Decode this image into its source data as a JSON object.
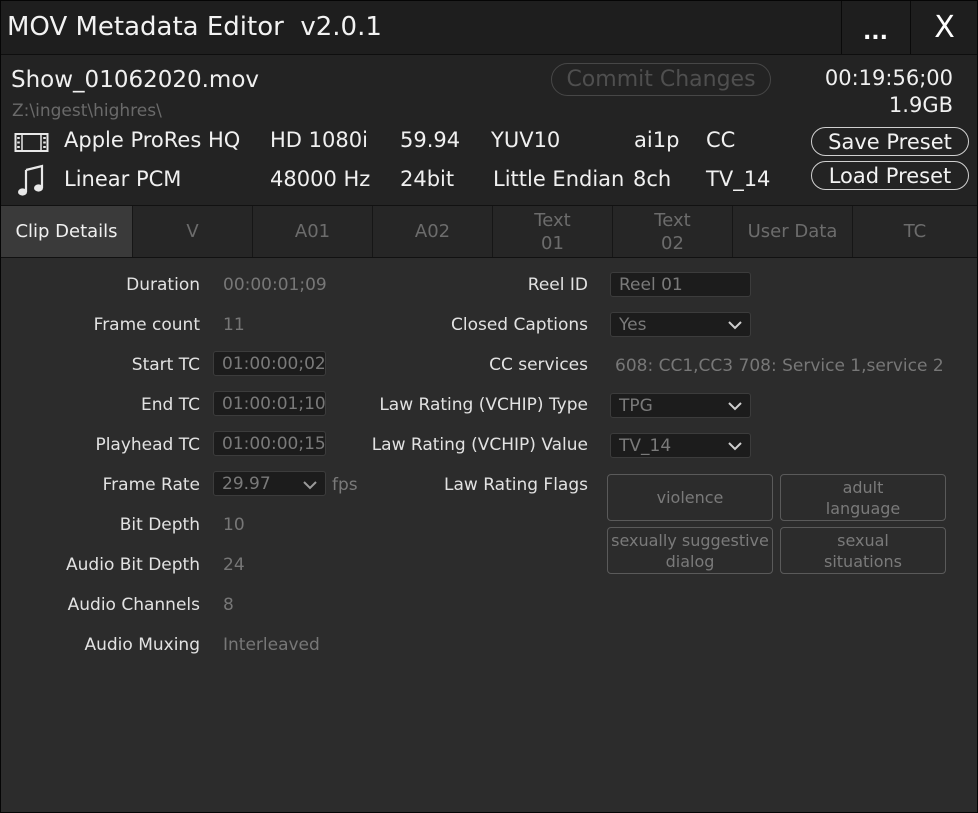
{
  "window": {
    "title": "MOV Metadata Editor  v2.0.1",
    "more_label": "...",
    "close_label": "X"
  },
  "file": {
    "name": "Show_01062020.mov",
    "path": "Z:\\ingest\\highres\\",
    "duration": "00:19:56;00",
    "size": "1.9GB",
    "commit_label": "Commit Changes"
  },
  "video_info": {
    "icon": "film-icon",
    "codec": "Apple ProRes HQ",
    "resolution": "HD 1080i",
    "framerate": "59.94",
    "colorspace": "YUV10",
    "format": "ai1p",
    "cc": "CC"
  },
  "audio_info": {
    "icon": "music-note-icon",
    "codec": "Linear PCM",
    "samplerate": "48000 Hz",
    "bitdepth": "24bit",
    "endian": "Little Endian",
    "channels": "8ch",
    "rating": "TV_14"
  },
  "presets": {
    "save_label": "Save Preset",
    "load_label": "Load Preset"
  },
  "tabs": [
    {
      "label": "Clip Details",
      "active": true
    },
    {
      "label": "V"
    },
    {
      "label": "A01"
    },
    {
      "label": "A02"
    },
    {
      "label": "Text\n01"
    },
    {
      "label": "Text\n02"
    },
    {
      "label": "User Data"
    },
    {
      "label": "TC"
    }
  ],
  "clip": {
    "duration_label": "Duration",
    "duration": "00:00:01;09",
    "frame_count_label": "Frame count",
    "frame_count": "11",
    "start_tc_label": "Start TC",
    "start_tc": "01:00:00;02",
    "end_tc_label": "End TC",
    "end_tc": "01:00:01;10",
    "playhead_tc_label": "Playhead TC",
    "playhead_tc": "01:00:00;15",
    "frame_rate_label": "Frame Rate",
    "frame_rate": "29.97",
    "frame_rate_unit": "fps",
    "bit_depth_label": "Bit Depth",
    "bit_depth": "10",
    "audio_bit_depth_label": "Audio Bit Depth",
    "audio_bit_depth": "24",
    "audio_channels_label": "Audio Channels",
    "audio_channels": "8",
    "audio_muxing_label": "Audio Muxing",
    "audio_muxing": "Interleaved"
  },
  "meta": {
    "reel_id_label": "Reel ID",
    "reel_id": "Reel 01",
    "closed_captions_label": "Closed Captions",
    "closed_captions": "Yes",
    "cc_services_label": "CC services",
    "cc_services": "608: CC1,CC3 708: Service 1,service 2",
    "law_type_label": "Law Rating (VCHIP) Type",
    "law_type": "TPG",
    "law_value_label": "Law Rating (VCHIP) Value",
    "law_value": "TV_14",
    "law_flags_label": "Law Rating Flags",
    "flags": [
      "violence",
      "adult\nlanguage",
      "sexually suggestive\ndialog",
      "sexual\nsituations"
    ]
  }
}
